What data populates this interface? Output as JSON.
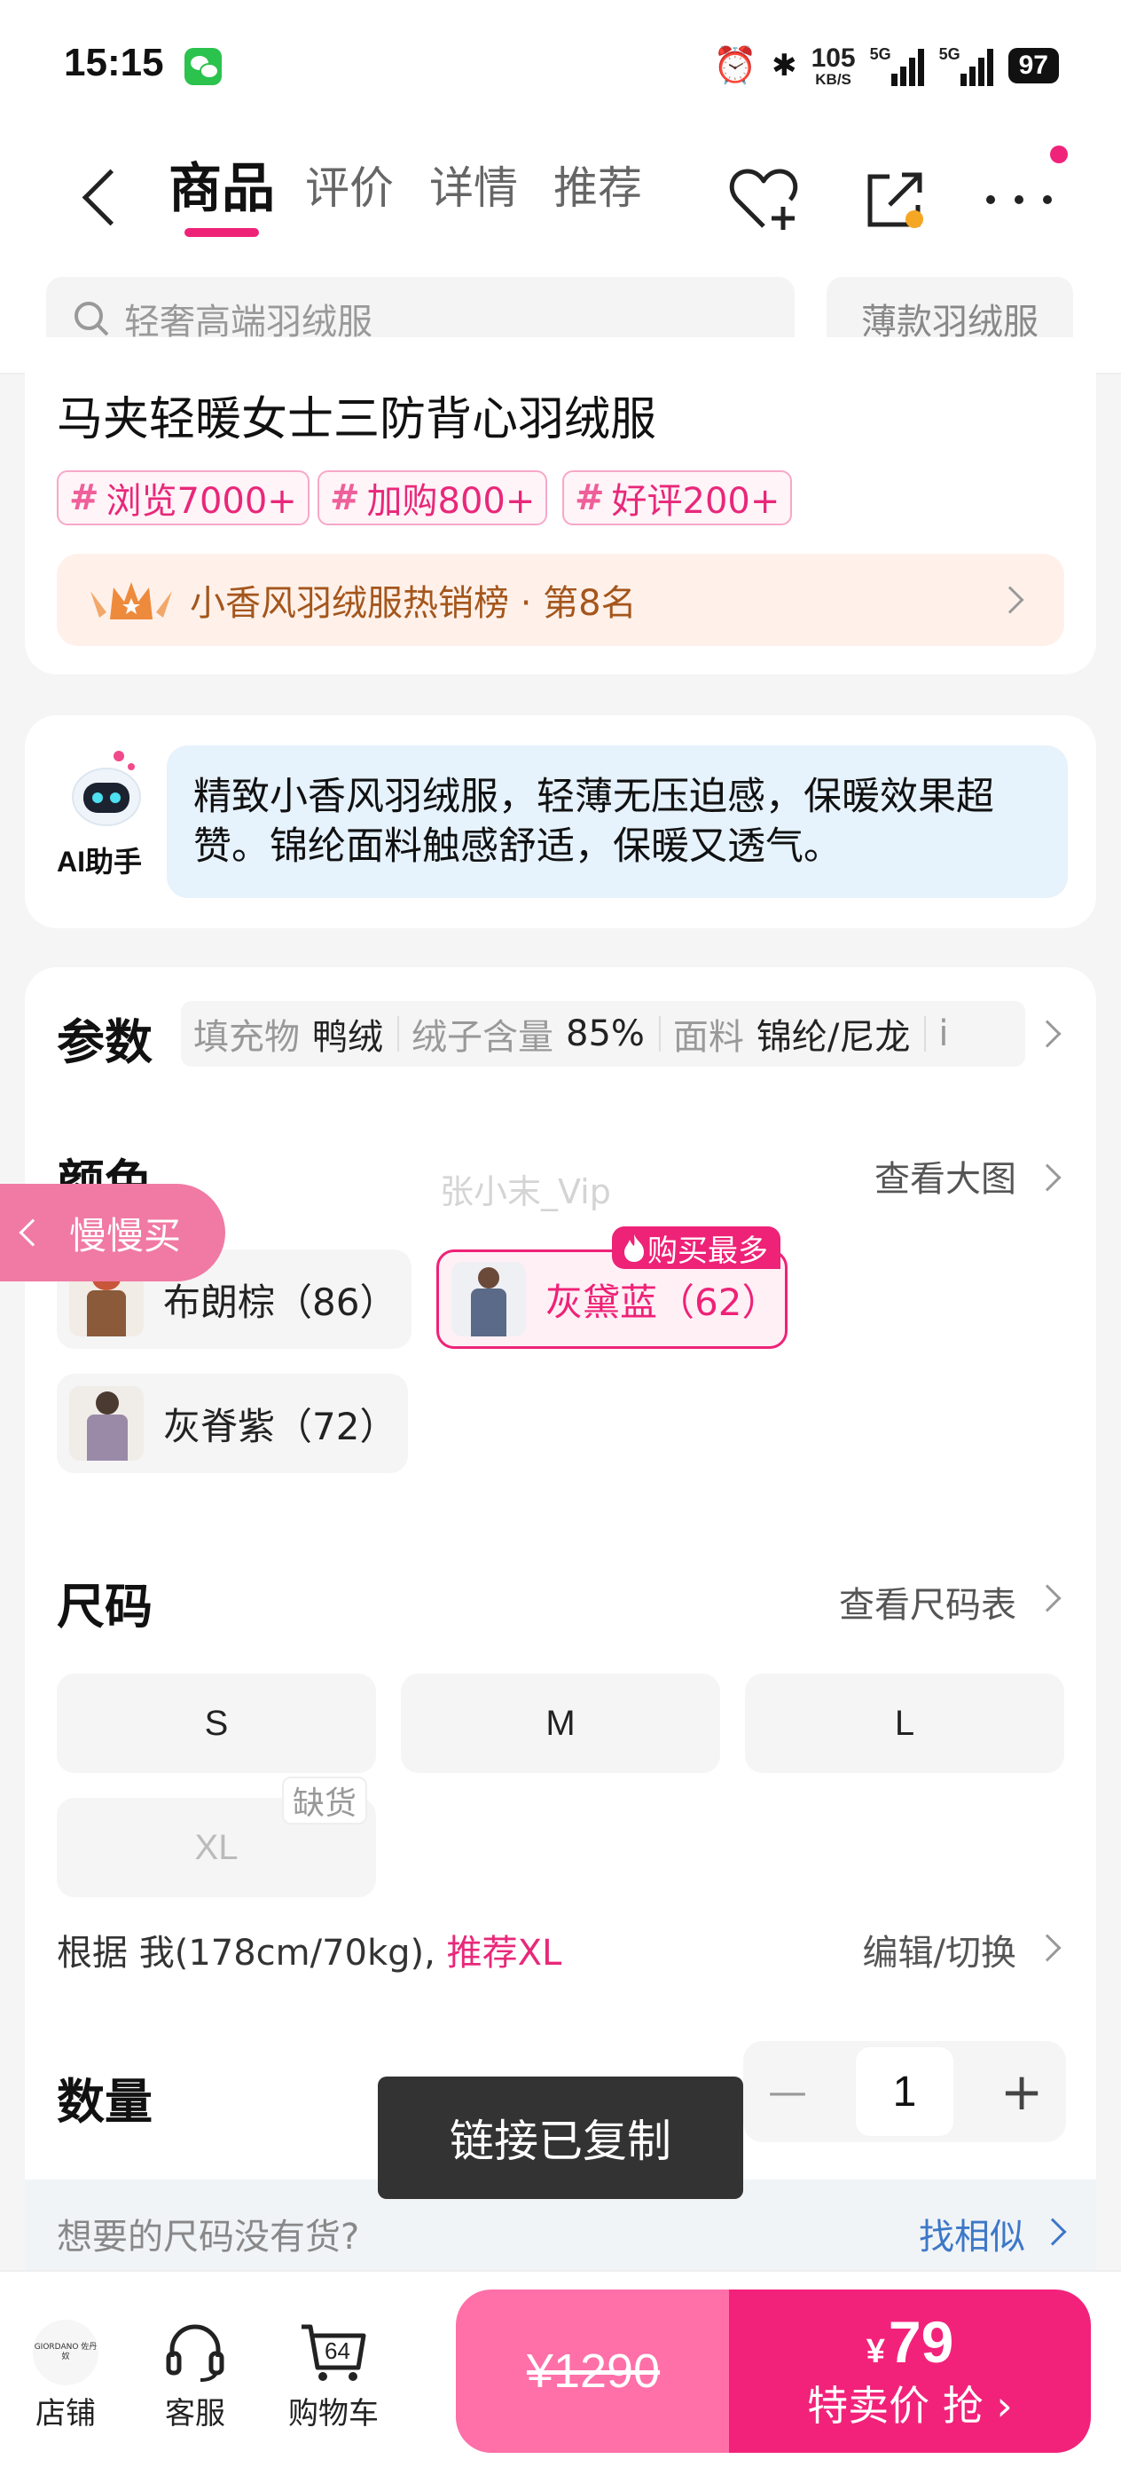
{
  "status": {
    "time": "15:15",
    "net_speed": "105",
    "net_unit": "KB/S",
    "sig1": "5G",
    "sig2": "5G",
    "battery": "97"
  },
  "nav": {
    "tabs": [
      "商品",
      "评价",
      "详情",
      "推荐"
    ],
    "active": "商品"
  },
  "search": {
    "placeholder": "轻奢高端羽绒服",
    "chip": "薄款羽绒服"
  },
  "product": {
    "title": "马夹轻暖女士三防背心羽绒服",
    "tags": [
      "浏览7000+",
      "加购800+",
      "好评200+"
    ],
    "rank": "小香风羽绒服热销榜 · 第8名"
  },
  "ai": {
    "label": "AI助手",
    "text": "精致小香风羽绒服，轻薄无压迫感，保暖效果超赞。锦纶面料触感舒适，保暖又透气。"
  },
  "params": {
    "title": "参数",
    "items": [
      {
        "k": "填充物",
        "v": "鸭绒"
      },
      {
        "k": "绒子含量",
        "v": "85%"
      },
      {
        "k": "面料",
        "v": "锦纶/尼龙"
      },
      {
        "k": "i",
        "v": ""
      }
    ]
  },
  "color": {
    "title": "颜色",
    "link": "查看大图",
    "hot_badge": "购买最多",
    "options": [
      {
        "label": "布朗棕（86）",
        "thumb": "#8a5a3a"
      },
      {
        "label": "灰黛蓝（62）",
        "thumb": "#5a6a88",
        "selected": true
      },
      {
        "label": "灰脊紫（72）",
        "thumb": "#9a8aa8"
      }
    ]
  },
  "size": {
    "title": "尺码",
    "link": "查看尺码表",
    "options": [
      "S",
      "M",
      "L",
      "XL"
    ],
    "out_of_stock": "缺货",
    "rec_prefix": "根据 我(178cm/70kg),",
    "rec_highlight": "推荐XL",
    "edit": "编辑/切换"
  },
  "quantity": {
    "title": "数量",
    "value": "1",
    "minus": "—",
    "plus": "+"
  },
  "hint": {
    "text": "想要的尺码没有货?",
    "link": "找相似"
  },
  "toast": "链接已复制",
  "slow_buy": "慢慢买",
  "watermark": "张小末_Vip",
  "bottom": {
    "shop": "店铺",
    "service": "客服",
    "cart": "购物车",
    "cart_count": "64",
    "logo_text": "GIORDANO 佐丹奴",
    "orig_price": "¥1290",
    "sale_currency": "¥",
    "sale_price": "79",
    "sale_cta": "特卖价 抢"
  },
  "colors": {
    "accent": "#ee2277",
    "sale_bg": "#f2227a",
    "orig_bg": "#ff6fa8"
  }
}
